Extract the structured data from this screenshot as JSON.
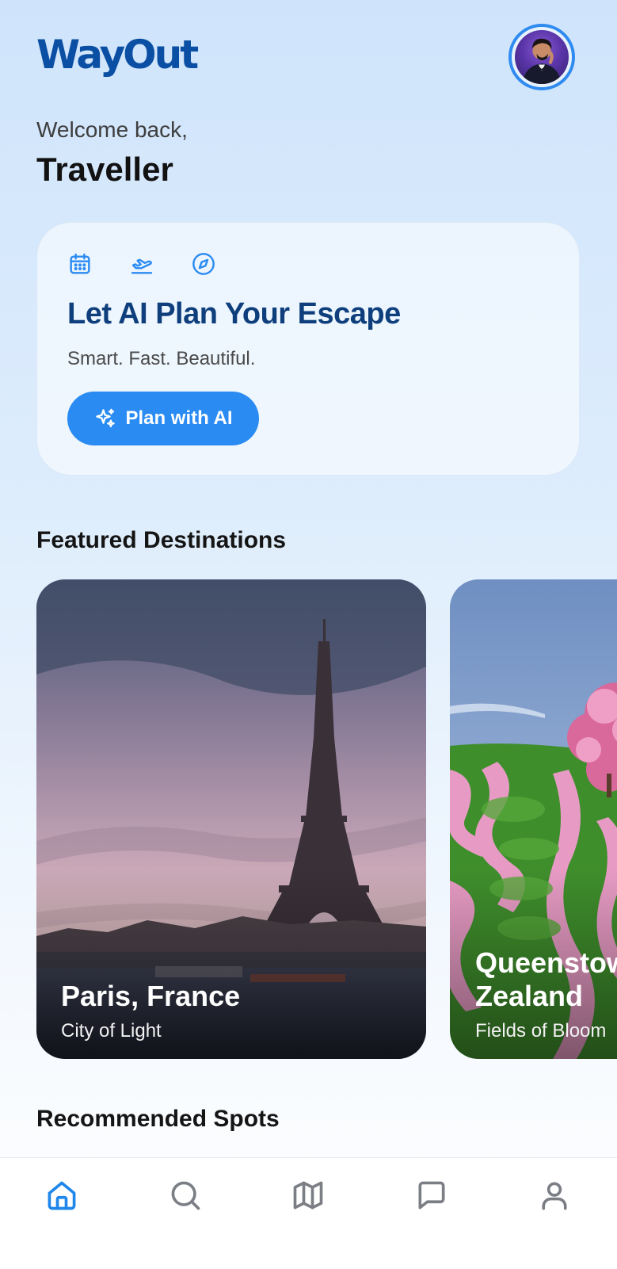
{
  "app": {
    "logo": "WayOut"
  },
  "header": {
    "avatar_alt": "profile-avatar"
  },
  "greeting": {
    "welcome": "Welcome back,",
    "name": "Traveller"
  },
  "ai_card": {
    "icons": [
      "calendar-icon",
      "plane-takeoff-icon",
      "compass-icon"
    ],
    "title": "Let AI Plan Your Escape",
    "subtitle": "Smart. Fast. Beautiful.",
    "button_label": "Plan with AI",
    "button_icon": "sparkles-icon"
  },
  "featured": {
    "title": "Featured Destinations",
    "cards": [
      {
        "name": "Paris, France",
        "tagline": "City of Light"
      },
      {
        "name": "Queenstown, New Zealand",
        "name_visible_line1": "Queenstow",
        "name_visible_line2": "Zealand",
        "tagline": "Fields of Bloom"
      }
    ]
  },
  "recommended": {
    "title": "Recommended Spots"
  },
  "bottom_nav": {
    "items": [
      {
        "id": "home",
        "icon": "home-icon",
        "active": true
      },
      {
        "id": "search",
        "icon": "search-icon",
        "active": false
      },
      {
        "id": "map",
        "icon": "map-icon",
        "active": false
      },
      {
        "id": "messages",
        "icon": "chat-icon",
        "active": false
      },
      {
        "id": "profile",
        "icon": "user-icon",
        "active": false
      }
    ]
  },
  "colors": {
    "brand": "#0a4fa3",
    "accent": "#2a8bf2",
    "title_dark": "#0e3f7c",
    "nav_active": "#1f86ea",
    "nav_inactive": "#7b7f85"
  }
}
